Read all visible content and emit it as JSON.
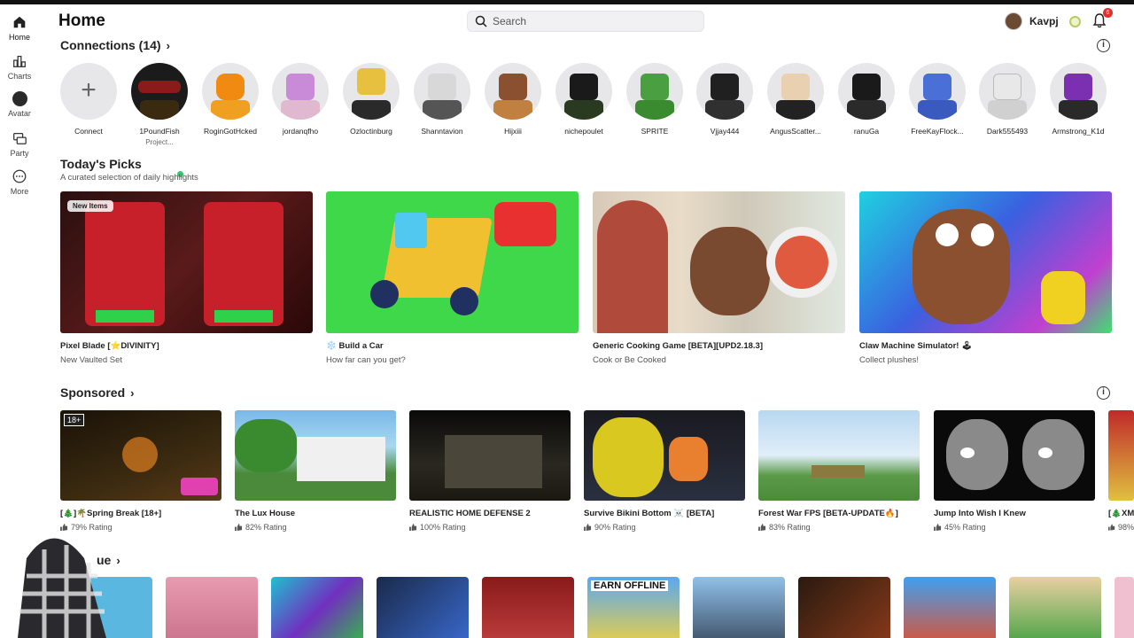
{
  "header": {
    "title": "Home",
    "search_placeholder": "Search",
    "username": "Kavpj",
    "notification_count": "6"
  },
  "nav": [
    {
      "label": "Home",
      "icon": "home-icon"
    },
    {
      "label": "Charts",
      "icon": "charts-icon"
    },
    {
      "label": "Avatar",
      "icon": "avatar-icon"
    },
    {
      "label": "Party",
      "icon": "party-icon"
    },
    {
      "label": "More",
      "icon": "more-icon"
    }
  ],
  "connections": {
    "title": "Connections (14)",
    "items": [
      {
        "name": "Connect",
        "sub": ""
      },
      {
        "name": "1PoundFish",
        "sub": "Project..."
      },
      {
        "name": "RoginGotHcked",
        "sub": ""
      },
      {
        "name": "jordanqfho",
        "sub": ""
      },
      {
        "name": "Ozloctinburg",
        "sub": ""
      },
      {
        "name": "Shanntavion",
        "sub": ""
      },
      {
        "name": "Hijxiii",
        "sub": ""
      },
      {
        "name": "nichepoulet",
        "sub": ""
      },
      {
        "name": "SPRITE",
        "sub": ""
      },
      {
        "name": "Vjjay444",
        "sub": ""
      },
      {
        "name": "AngusScatter...",
        "sub": ""
      },
      {
        "name": "ranuGa",
        "sub": ""
      },
      {
        "name": "FreeKayFlock...",
        "sub": ""
      },
      {
        "name": "Dark555493",
        "sub": ""
      },
      {
        "name": "Armstrong_K1d",
        "sub": ""
      }
    ]
  },
  "picks": {
    "title": "Today's Picks",
    "subtitle": "A curated selection of daily highlights",
    "items": [
      {
        "title": "Pixel Blade [⭐DIVINITY]",
        "sub": "New Vaulted Set",
        "tag": "New Items"
      },
      {
        "title": "❄️ Build a Car",
        "sub": "How far can you get?"
      },
      {
        "title": "Generic Cooking Game [BETA][UPD2.18.3]",
        "sub": "Cook or Be Cooked"
      },
      {
        "title": "Claw Machine Simulator! 🕹",
        "sub": "Collect plushes!"
      }
    ]
  },
  "sponsored": {
    "title": "Sponsored",
    "items": [
      {
        "title": "[🎄]🌴Spring Break [18+]",
        "rating": "79% Rating"
      },
      {
        "title": "The Lux House",
        "rating": "82% Rating"
      },
      {
        "title": "REALISTIC HOME DEFENSE 2",
        "rating": "100% Rating"
      },
      {
        "title": "Survive Bikini Bottom ☠️ [BETA]",
        "rating": "90% Rating"
      },
      {
        "title": "Forest War FPS [BETA-UPDATE🔥]",
        "rating": "83% Rating"
      },
      {
        "title": "Jump Into Wish I Knew",
        "rating": "45% Rating"
      },
      {
        "title": "[🎄XM",
        "rating": "98%"
      }
    ]
  },
  "continue": {
    "title": "ue"
  },
  "colors": {
    "accent_green": "#2ecc71",
    "badge_red": "#e0312c"
  }
}
